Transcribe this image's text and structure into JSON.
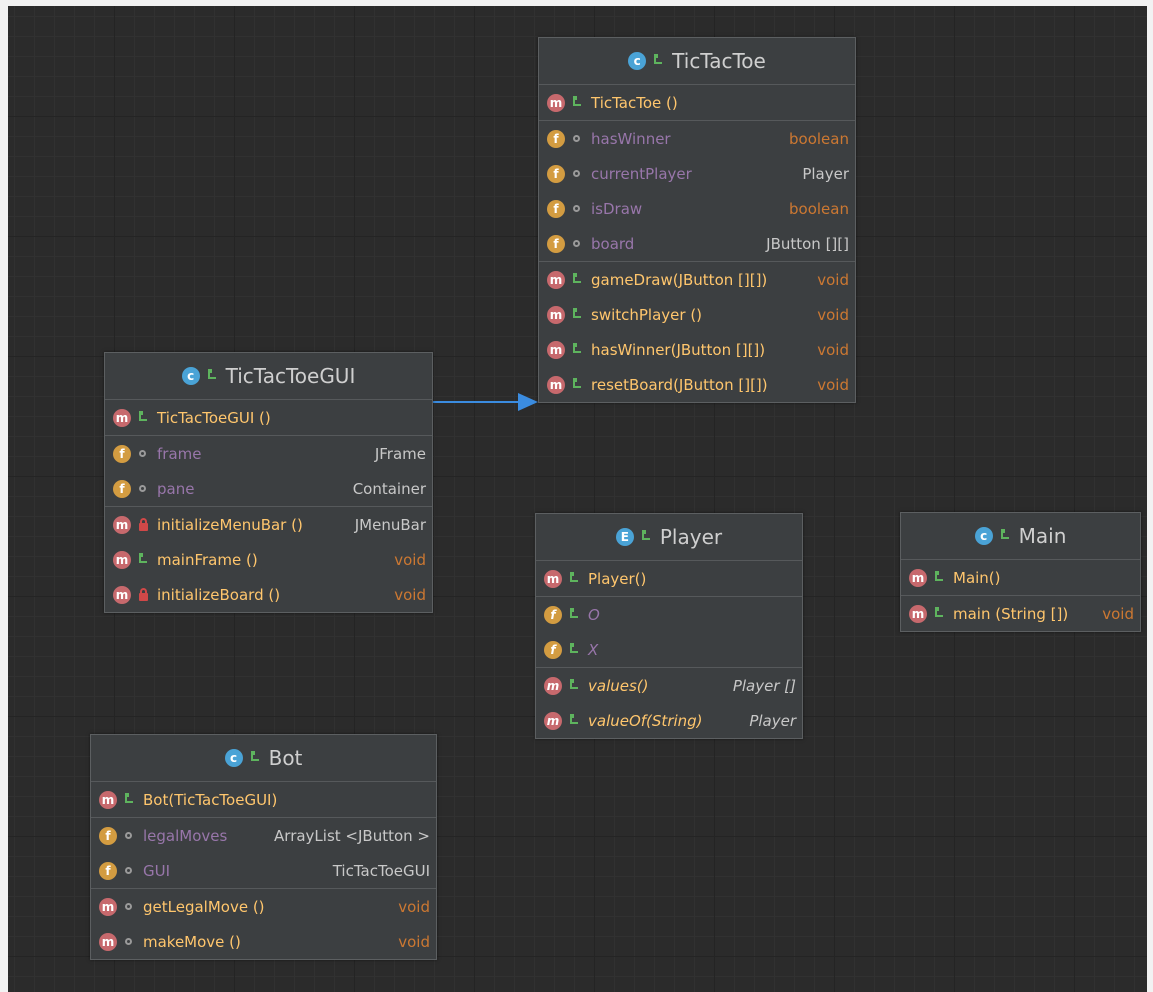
{
  "colors": {
    "background": "#2b2b2b",
    "box": "#3c3f41",
    "method_name": "#ffc66d",
    "field_name": "#9876aa",
    "primitive_type": "#cc7832",
    "arrow": "#3b8ce0"
  },
  "classes": {
    "tictactoe": {
      "name": "TicTacToe",
      "kind_letter": "c",
      "constructors": [
        {
          "kind": "m",
          "vis": "public",
          "label": "TicTacToe ()",
          "type": ""
        }
      ],
      "fields": [
        {
          "kind": "f",
          "vis": "package",
          "label": "hasWinner",
          "type": "boolean"
        },
        {
          "kind": "f",
          "vis": "package",
          "label": "currentPlayer",
          "type": "Player"
        },
        {
          "kind": "f",
          "vis": "package",
          "label": "isDraw",
          "type": "boolean"
        },
        {
          "kind": "f",
          "vis": "package",
          "label": "board",
          "type": "JButton [][]"
        }
      ],
      "methods": [
        {
          "kind": "m",
          "vis": "public",
          "label": "gameDraw(JButton [][])",
          "type": "void"
        },
        {
          "kind": "m",
          "vis": "public",
          "label": "switchPlayer ()",
          "type": "void"
        },
        {
          "kind": "m",
          "vis": "public",
          "label": "hasWinner(JButton [][])",
          "type": "void"
        },
        {
          "kind": "m",
          "vis": "public",
          "label": "resetBoard(JButton [][])",
          "type": "void"
        }
      ]
    },
    "gui": {
      "name": "TicTacToeGUI",
      "kind_letter": "c",
      "constructors": [
        {
          "kind": "m",
          "vis": "public",
          "label": "TicTacToeGUI ()",
          "type": ""
        }
      ],
      "fields": [
        {
          "kind": "f",
          "vis": "package",
          "label": "frame",
          "type": "JFrame"
        },
        {
          "kind": "f",
          "vis": "package",
          "label": "pane",
          "type": "Container"
        }
      ],
      "methods": [
        {
          "kind": "m",
          "vis": "private",
          "label": "initializeMenuBar ()",
          "type": "JMenuBar"
        },
        {
          "kind": "m",
          "vis": "public",
          "label": "mainFrame ()",
          "type": "void"
        },
        {
          "kind": "m",
          "vis": "private",
          "label": "initializeBoard ()",
          "type": "void"
        }
      ]
    },
    "player": {
      "name": "Player",
      "kind_letter": "E",
      "constructors": [
        {
          "kind": "m",
          "vis": "public",
          "label": "Player()",
          "type": ""
        }
      ],
      "fields": [
        {
          "kind": "f",
          "vis": "public",
          "label": "O",
          "type": ""
        },
        {
          "kind": "f",
          "vis": "public",
          "label": "X",
          "type": ""
        }
      ],
      "methods": [
        {
          "kind": "m",
          "vis": "public",
          "label": "values()",
          "type": "Player []"
        },
        {
          "kind": "m",
          "vis": "public",
          "label": "valueOf(String)",
          "type": "Player"
        }
      ]
    },
    "main": {
      "name": "Main",
      "kind_letter": "c",
      "constructors": [
        {
          "kind": "m",
          "vis": "public",
          "label": "Main()",
          "type": ""
        }
      ],
      "fields": [],
      "methods": [
        {
          "kind": "m",
          "vis": "public",
          "label": "main (String [])",
          "type": "void"
        }
      ]
    },
    "bot": {
      "name": "Bot",
      "kind_letter": "c",
      "constructors": [
        {
          "kind": "m",
          "vis": "public",
          "label": "Bot(TicTacToeGUI)",
          "type": ""
        }
      ],
      "fields": [
        {
          "kind": "f",
          "vis": "package",
          "label": "legalMoves",
          "type": "ArrayList <JButton >"
        },
        {
          "kind": "f",
          "vis": "package",
          "label": "GUI",
          "type": "TicTacToeGUI"
        }
      ],
      "methods": [
        {
          "kind": "m",
          "vis": "package",
          "label": "getLegalMove ()",
          "type": "void"
        },
        {
          "kind": "m",
          "vis": "package",
          "label": "makeMove ()",
          "type": "void"
        }
      ]
    }
  }
}
